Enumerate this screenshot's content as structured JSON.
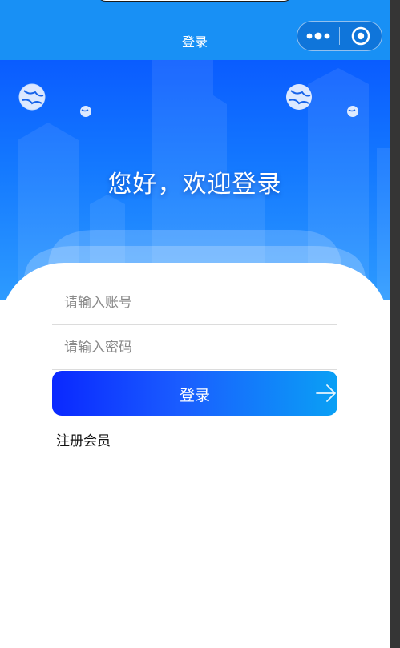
{
  "navbar": {
    "title": "登录",
    "menu_icon": "more-dots-icon",
    "close_icon": "target-circle-icon"
  },
  "banner": {
    "welcome_text": "您好，欢迎登录"
  },
  "form": {
    "account_placeholder": "请输入账号",
    "password_placeholder": "请输入密码",
    "login_label": "登录",
    "login_arrow_icon": "arrow-right-icon",
    "register_label": "注册会员"
  },
  "colors": {
    "navbar": "#1890f5",
    "banner_top": "#0a5cff",
    "banner_bottom": "#2d9bff",
    "button_start": "#0a28ff",
    "button_end": "#0aa0f5"
  }
}
